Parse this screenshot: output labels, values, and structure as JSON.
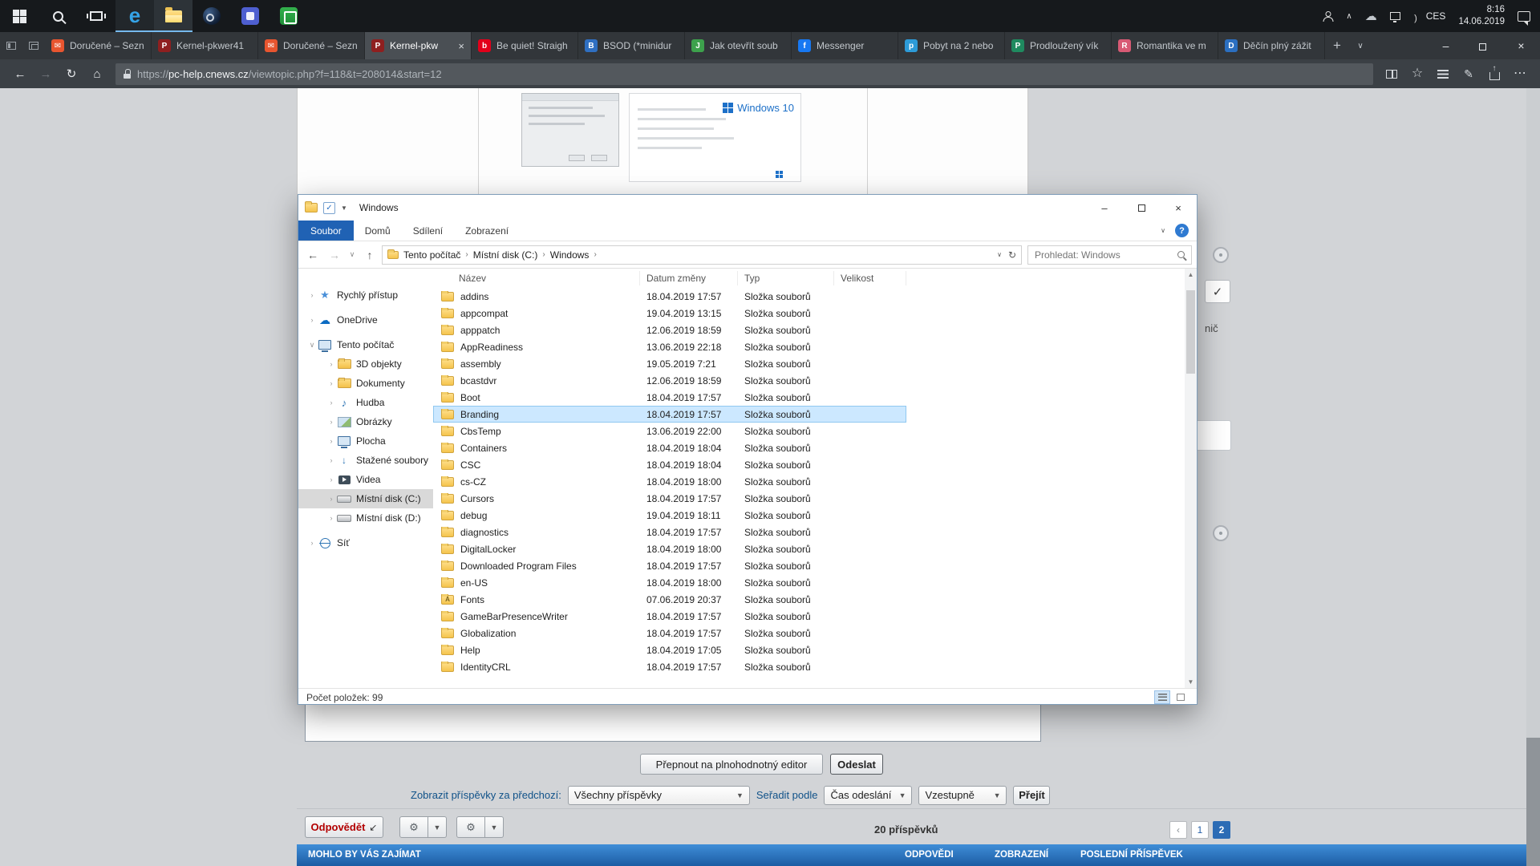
{
  "taskbar": {
    "tray": {
      "lang": "CES",
      "time": "8:16",
      "date": "14.06.2019"
    }
  },
  "browser": {
    "tabs": [
      {
        "title": "Doručené – Sezn",
        "color": "#e8552f",
        "glyph": "✉"
      },
      {
        "title": "Kernel-pkwer41",
        "color": "#8f1f1f",
        "glyph": "P"
      },
      {
        "title": "Doručené – Sezn",
        "color": "#e8552f",
        "glyph": "✉"
      },
      {
        "title": "Kernel-pkw",
        "color": "#8f1f1f",
        "glyph": "P",
        "active": true
      },
      {
        "title": "Be quiet! Straigh",
        "color": "#e2001a",
        "glyph": "b"
      },
      {
        "title": "BSOD (*minidur",
        "color": "#2f6fc1",
        "glyph": "B"
      },
      {
        "title": "Jak otevřít soub",
        "color": "#3da14c",
        "glyph": "J"
      },
      {
        "title": "Messenger",
        "color": "#1778f2",
        "glyph": "f"
      },
      {
        "title": "Pobyt na 2 nebo",
        "color": "#2d9bd8",
        "glyph": "p"
      },
      {
        "title": "Prodloužený vík",
        "color": "#1f8a5f",
        "glyph": "P"
      },
      {
        "title": "Romantika ve m",
        "color": "#d85a74",
        "glyph": "R"
      },
      {
        "title": "Děčín plný zážit",
        "color": "#2b6fc0",
        "glyph": "D"
      }
    ],
    "new_tab_label": "+",
    "url": {
      "scheme": "https://",
      "host": "pc-help.cnews.cz",
      "path": "/viewtopic.php?f=118&t=208014&start=12"
    }
  },
  "explorer": {
    "title": "Windows",
    "file_menu": "Soubor",
    "menu_tabs": [
      {
        "label": "Domů"
      },
      {
        "label": "Sdílení"
      },
      {
        "label": "Zobrazení"
      }
    ],
    "breadcrumb": [
      {
        "label": "Tento počítač"
      },
      {
        "label": "Místní disk (C:)"
      },
      {
        "label": "Windows"
      }
    ],
    "search_placeholder": "Prohledat: Windows",
    "columns": {
      "name": "Název",
      "date": "Datum změny",
      "type": "Typ",
      "size": "Velikost"
    },
    "sidebar": [
      {
        "label": "Rychlý přístup",
        "icon": "star",
        "chev": "›",
        "root": true
      },
      {
        "label": "OneDrive",
        "icon": "cloud",
        "chev": "›",
        "root": true
      },
      {
        "label": "Tento počítač",
        "icon": "monitor",
        "chev": "∨",
        "root": true
      },
      {
        "label": "3D objekty",
        "icon": "folder",
        "chev": "›",
        "child": true
      },
      {
        "label": "Dokumenty",
        "icon": "folder",
        "chev": "›",
        "child": true
      },
      {
        "label": "Hudba",
        "icon": "music",
        "chev": "›",
        "child": true
      },
      {
        "label": "Obrázky",
        "icon": "picture",
        "chev": "›",
        "child": true
      },
      {
        "label": "Plocha",
        "icon": "monitor",
        "chev": "›",
        "child": true
      },
      {
        "label": "Stažené soubory",
        "icon": "download",
        "chev": "›",
        "child": true
      },
      {
        "label": "Videa",
        "icon": "video",
        "chev": "›",
        "child": true
      },
      {
        "label": "Místní disk (C:)",
        "icon": "drive",
        "chev": "›",
        "child": true,
        "selected": true
      },
      {
        "label": "Místní disk (D:)",
        "icon": "drive",
        "chev": "›",
        "child": true
      },
      {
        "label": "Síť",
        "icon": "network",
        "chev": "›",
        "root": true
      }
    ],
    "files": [
      {
        "name": "addins",
        "date": "18.04.2019 17:57",
        "type": "Složka souborů"
      },
      {
        "name": "appcompat",
        "date": "19.04.2019 13:15",
        "type": "Složka souborů"
      },
      {
        "name": "apppatch",
        "date": "12.06.2019 18:59",
        "type": "Složka souborů"
      },
      {
        "name": "AppReadiness",
        "date": "13.06.2019 22:18",
        "type": "Složka souborů"
      },
      {
        "name": "assembly",
        "date": "19.05.2019 7:21",
        "type": "Složka souborů"
      },
      {
        "name": "bcastdvr",
        "date": "12.06.2019 18:59",
        "type": "Složka souborů"
      },
      {
        "name": "Boot",
        "date": "18.04.2019 17:57",
        "type": "Složka souborů"
      },
      {
        "name": "Branding",
        "date": "18.04.2019 17:57",
        "type": "Složka souborů",
        "selected": true
      },
      {
        "name": "CbsTemp",
        "date": "13.06.2019 22:00",
        "type": "Složka souborů"
      },
      {
        "name": "Containers",
        "date": "18.04.2019 18:04",
        "type": "Složka souborů"
      },
      {
        "name": "CSC",
        "date": "18.04.2019 18:04",
        "type": "Složka souborů"
      },
      {
        "name": "cs-CZ",
        "date": "18.04.2019 18:00",
        "type": "Složka souborů"
      },
      {
        "name": "Cursors",
        "date": "18.04.2019 17:57",
        "type": "Složka souborů"
      },
      {
        "name": "debug",
        "date": "19.04.2019 18:11",
        "type": "Složka souborů"
      },
      {
        "name": "diagnostics",
        "date": "18.04.2019 17:57",
        "type": "Složka souborů"
      },
      {
        "name": "DigitalLocker",
        "date": "18.04.2019 18:00",
        "type": "Složka souborů"
      },
      {
        "name": "Downloaded Program Files",
        "date": "18.04.2019 17:57",
        "type": "Složka souborů"
      },
      {
        "name": "en-US",
        "date": "18.04.2019 18:00",
        "type": "Složka souborů"
      },
      {
        "name": "Fonts",
        "date": "07.06.2019 20:37",
        "type": "Složka souborů",
        "badge": "A"
      },
      {
        "name": "GameBarPresenceWriter",
        "date": "18.04.2019 17:57",
        "type": "Složka souborů"
      },
      {
        "name": "Globalization",
        "date": "18.04.2019 17:57",
        "type": "Složka souborů"
      },
      {
        "name": "Help",
        "date": "18.04.2019 17:05",
        "type": "Složka souborů"
      },
      {
        "name": "IdentityCRL",
        "date": "18.04.2019 17:57",
        "type": "Složka souborů"
      }
    ],
    "status_text": "Počet položek: 99"
  },
  "forum": {
    "editor_switch": "Přepnout na plnohodnotný editor",
    "submit": "Odeslat",
    "display": {
      "show_label": "Zobrazit příspěvky za předchozí:",
      "show_value": "Všechny příspěvky",
      "sort_label": "Seřadit podle",
      "sort_value": "Čas odeslání",
      "dir_value": "Vzestupně",
      "go": "Přejít"
    },
    "reply": "Odpovědět",
    "post_count": "20 příspěvků",
    "pagination": {
      "prev": "‹",
      "pages": [
        {
          "n": "1"
        },
        {
          "n": "2",
          "current": true
        }
      ]
    },
    "suggest": {
      "title": "MOHLO BY VÁS ZAJÍMAT",
      "cols": [
        "ODPOVĚDI",
        "ZOBRAZENÍ",
        "POSLEDNÍ PŘÍSPĚVEK"
      ]
    },
    "bg": {
      "snippet": "nič",
      "thumb_brand": "Windows 10"
    }
  }
}
